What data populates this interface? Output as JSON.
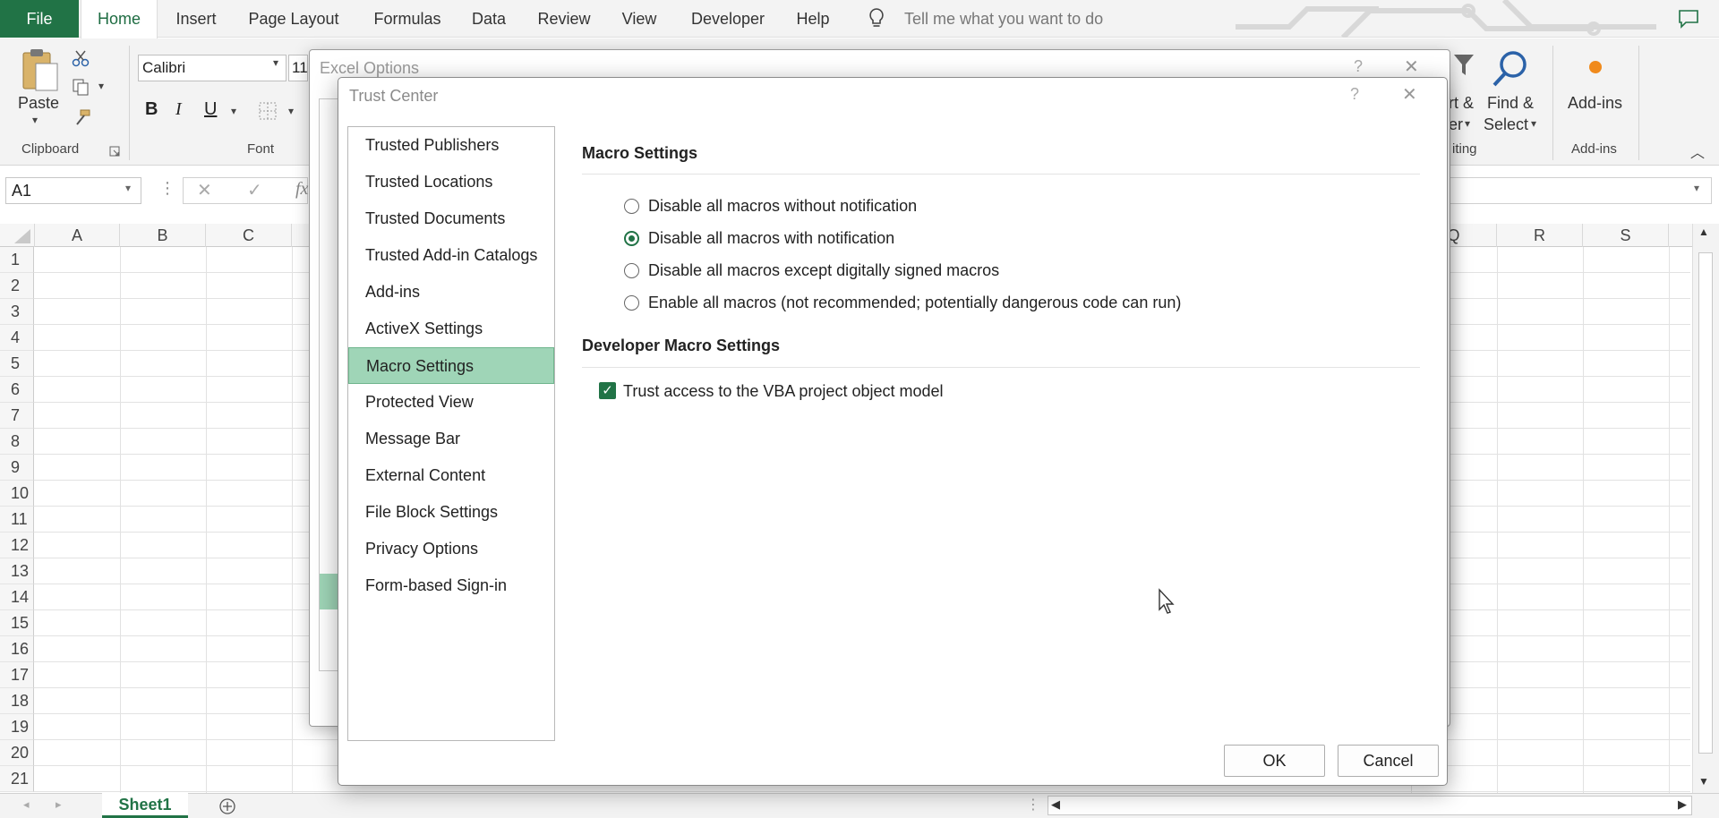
{
  "ribbon": {
    "file_tab": "File",
    "tabs": [
      "Home",
      "Insert",
      "Page Layout",
      "Formulas",
      "Data",
      "Review",
      "View",
      "Developer",
      "Help"
    ],
    "active_tab": "Home",
    "tell_me_placeholder": "Tell me what you want to do",
    "clipboard": {
      "paste_label": "Paste",
      "group_label": "Clipboard"
    },
    "font": {
      "font_name": "Calibri",
      "font_size": "11",
      "bold": "B",
      "italic": "I",
      "underline": "U",
      "group_label": "Font"
    },
    "editing": {
      "sort_partial_top": "rt &",
      "sort_partial_bottom": "er",
      "find_select_top": "Find &",
      "find_select_bottom": "Select",
      "group_label_partial": "iting"
    },
    "addins": {
      "label": "Add-ins",
      "group_label": "Add-ins"
    }
  },
  "formula_bar": {
    "name_box": "A1",
    "fx": "fx"
  },
  "grid": {
    "left_columns": [
      "A",
      "B",
      "C"
    ],
    "right_columns": [
      "Q",
      "R",
      "S"
    ],
    "rows": [
      "1",
      "2",
      "3",
      "4",
      "5",
      "6",
      "7",
      "8",
      "9",
      "10",
      "11",
      "12",
      "13",
      "14",
      "15",
      "16",
      "17",
      "18",
      "19",
      "20",
      "21"
    ]
  },
  "sheet_tabs": {
    "active": "Sheet1"
  },
  "excel_options": {
    "title": "Excel Options"
  },
  "trust_center": {
    "title": "Trust Center",
    "help": "?",
    "close": "✕",
    "nav_items": [
      "Trusted Publishers",
      "Trusted Locations",
      "Trusted Documents",
      "Trusted Add-in Catalogs",
      "Add-ins",
      "ActiveX Settings",
      "Macro Settings",
      "Protected View",
      "Message Bar",
      "External Content",
      "File Block Settings",
      "Privacy Options",
      "Form-based Sign-in"
    ],
    "selected_nav": "Macro Settings",
    "macro_settings": {
      "heading": "Macro Settings",
      "options": [
        {
          "label": "Disable all macros without notification",
          "selected": false
        },
        {
          "label": "Disable all macros with notification",
          "selected": true
        },
        {
          "label": "Disable all macros except digitally signed macros",
          "selected": false
        },
        {
          "label": "Enable all macros (not recommended; potentially dangerous code can run)",
          "selected": false
        }
      ]
    },
    "developer_settings": {
      "heading": "Developer Macro Settings",
      "trust_vba_label": "Trust access to the VBA project object model",
      "trust_vba_checked": true
    },
    "ok_label": "OK",
    "cancel_label": "Cancel"
  },
  "colors": {
    "excel_green": "#217346",
    "selected_nav_bg": "#9fd5b7"
  }
}
